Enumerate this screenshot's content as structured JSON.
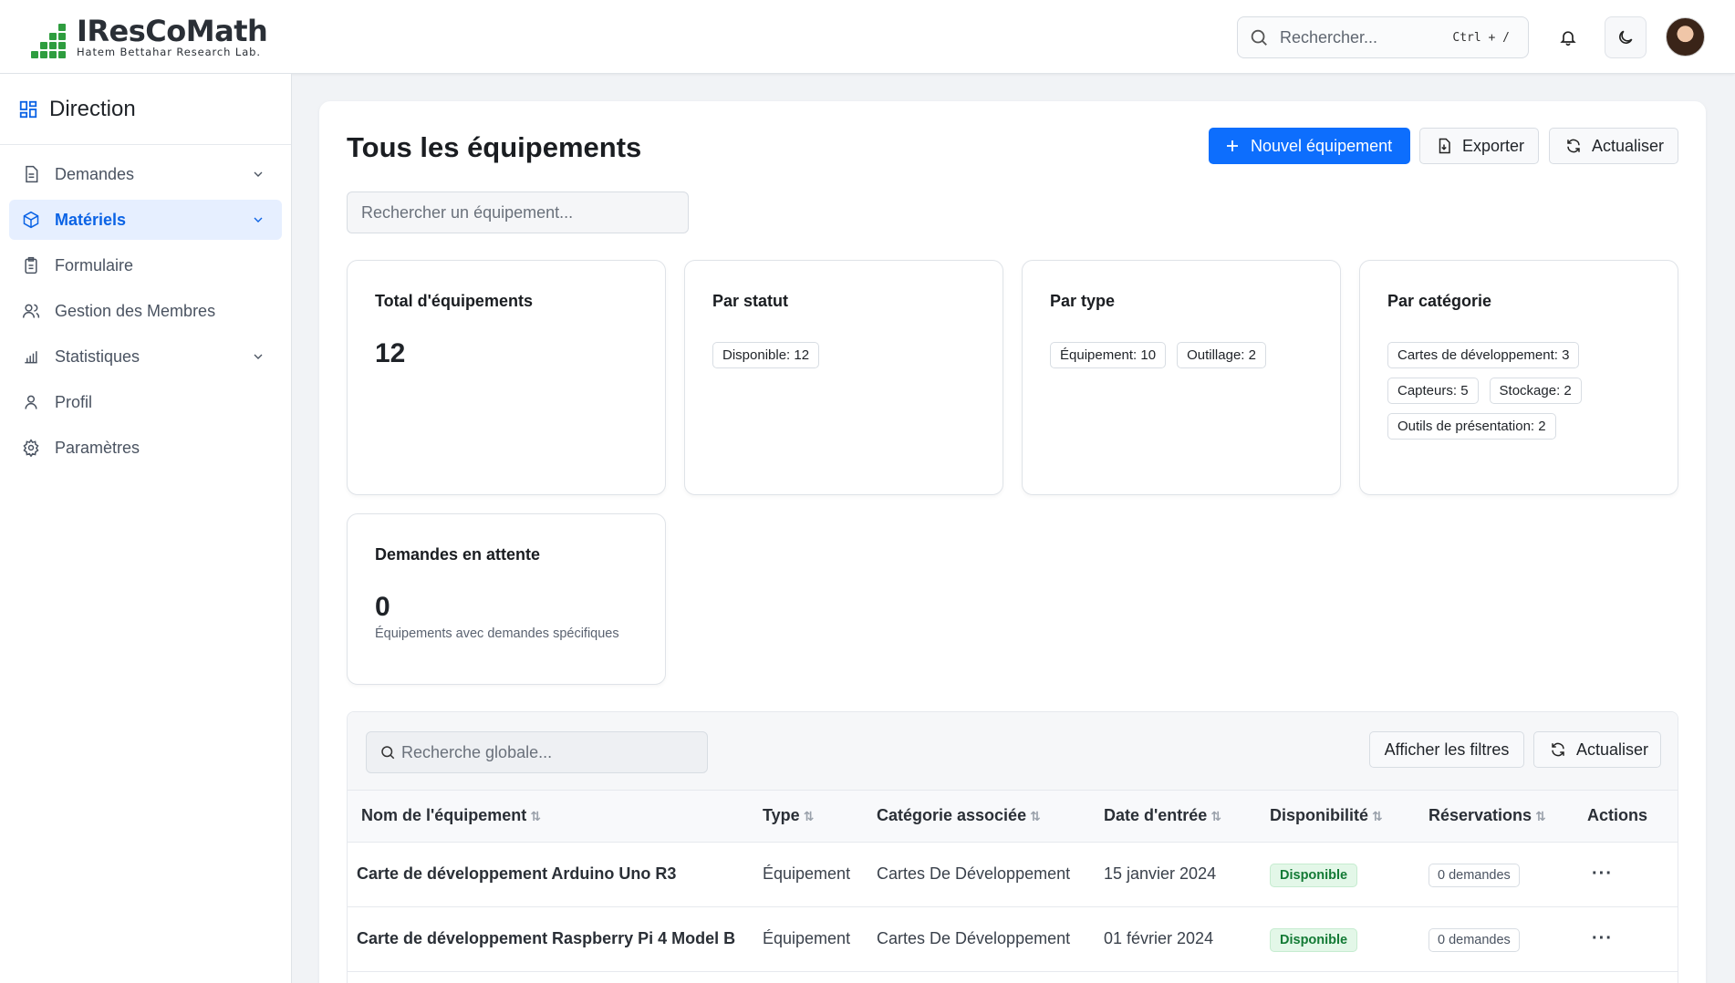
{
  "header": {
    "logo_title": "IResCoMath",
    "logo_subtitle": "Hatem Bettahar Research Lab.",
    "search_placeholder": "Rechercher...",
    "search_shortcut": "Ctrl + /"
  },
  "sidebar": {
    "title": "Direction",
    "items": [
      {
        "label": "Demandes",
        "icon": "file-text-icon",
        "has_chevron": true,
        "active": false
      },
      {
        "label": "Matériels",
        "icon": "box-icon",
        "has_chevron": true,
        "active": true
      },
      {
        "label": "Formulaire",
        "icon": "clipboard-icon",
        "has_chevron": false,
        "active": false
      },
      {
        "label": "Gestion des Membres",
        "icon": "users-icon",
        "has_chevron": false,
        "active": false
      },
      {
        "label": "Statistiques",
        "icon": "bar-chart-icon",
        "has_chevron": true,
        "active": false
      },
      {
        "label": "Profil",
        "icon": "user-icon",
        "has_chevron": false,
        "active": false
      },
      {
        "label": "Paramètres",
        "icon": "gear-icon",
        "has_chevron": false,
        "active": false
      }
    ]
  },
  "page": {
    "title": "Tous les équipements",
    "new_button": "Nouvel équipement",
    "export_button": "Exporter",
    "refresh_button": "Actualiser",
    "search_placeholder": "Rechercher un équipement..."
  },
  "stats": {
    "total": {
      "title": "Total d'équipements",
      "value": "12"
    },
    "status": {
      "title": "Par statut",
      "chips": [
        "Disponible: 12"
      ]
    },
    "type": {
      "title": "Par type",
      "chips": [
        "Équipement: 10",
        "Outillage: 2"
      ]
    },
    "category": {
      "title": "Par catégorie",
      "chips": [
        "Cartes de développement: 3",
        "Capteurs: 5",
        "Stockage: 2",
        "Outils de présentation: 2"
      ]
    },
    "pending": {
      "title": "Demandes en attente",
      "value": "0",
      "note": "Équipements avec demandes spécifiques"
    }
  },
  "table": {
    "search_placeholder": "Recherche globale...",
    "filters_button": "Afficher les filtres",
    "refresh_button": "Actualiser",
    "columns": [
      "Nom de l'équipement",
      "Type",
      "Catégorie associée",
      "Date d'entrée",
      "Disponibilité",
      "Réservations",
      "Actions"
    ],
    "rows": [
      {
        "name": "Carte de développement Arduino Uno R3",
        "type": "Équipement",
        "category": "Cartes De Développement",
        "date": "15 janvier 2024",
        "availability": "Disponible",
        "reservations": "0 demandes",
        "actions": "···"
      },
      {
        "name": "Carte de développement Raspberry Pi 4 Model B",
        "type": "Équipement",
        "category": "Cartes De Développement",
        "date": "01 février 2024",
        "availability": "Disponible",
        "reservations": "0 demandes",
        "actions": "···"
      }
    ]
  },
  "colors": {
    "primary": "#0d6efd",
    "brand_green": "#2e9d3f",
    "active_bg": "#e6efff",
    "available": "#137a35"
  }
}
